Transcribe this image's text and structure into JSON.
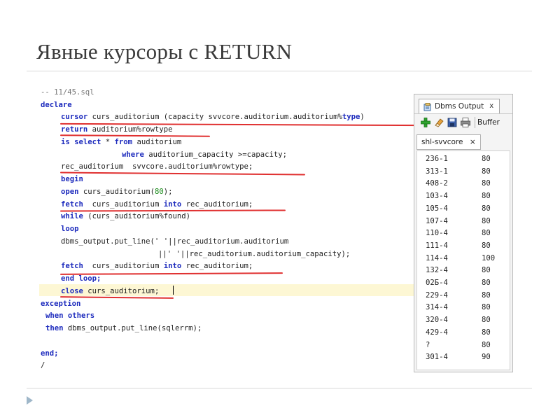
{
  "slide": {
    "title": "Явные курсоры с RETURN"
  },
  "code": {
    "comment": "-- 11/45.sql",
    "l2": "declare",
    "l3a": "cursor",
    "l3b": " curs_auditorium (capacity svvcore.auditorium.auditorium%",
    "l3c": "type",
    "l3d": ")",
    "l4a": "return",
    "l4b": " auditorium%rowtype",
    "l5a": "is select",
    "l5b": " * ",
    "l5c": "from",
    "l5d": " auditorium",
    "l6a": "where",
    "l6b": " auditorium_capacity >=capacity;",
    "l7": "rec_auditorium  svvcore.auditorium%rowtype;",
    "l8": "begin",
    "l9a": "open",
    "l9b": " curs_auditorium(",
    "l9c": "80",
    "l9d": ");",
    "l10a": "fetch",
    "l10b": "  curs_auditorium ",
    "l10c": "into",
    "l10d": " rec_auditorium;",
    "l11a": "while",
    "l11b": " (curs_auditorium%found)",
    "l12": "loop",
    "l13": "dbms_output.put_line(' '||rec_auditorium.auditorium",
    "l14": "||' '||rec_auditorium.auditorium_capacity);",
    "l15a": "fetch",
    "l15b": "  curs_auditorium ",
    "l15c": "into",
    "l15d": " rec_auditorium;",
    "l16": "end loop;",
    "l17a": "close",
    "l17b": " curs_auditorium;",
    "l18": "exception",
    "l19": "when others",
    "l20a": "then",
    "l20b": " dbms_output.put_line(sqlerrm);",
    "l21": "end;",
    "l22": "/"
  },
  "dbms_panel": {
    "tab_label": "Dbms Output",
    "close_glyph": "x",
    "toolbar": {
      "buffer_label": "Buffer"
    },
    "subtab_label": "shl-svvcore",
    "subtab_close": "×",
    "rows": [
      [
        "236-1",
        "80"
      ],
      [
        "313-1",
        "80"
      ],
      [
        "408-2",
        "80"
      ],
      [
        "103-4",
        "80"
      ],
      [
        "105-4",
        "80"
      ],
      [
        "107-4",
        "80"
      ],
      [
        "110-4",
        "80"
      ],
      [
        "111-4",
        "80"
      ],
      [
        "114-4",
        "100"
      ],
      [
        "132-4",
        "80"
      ],
      [
        "02Б-4",
        "80"
      ],
      [
        "229-4",
        "80"
      ],
      [
        "314-4",
        "80"
      ],
      [
        "320-4",
        "80"
      ],
      [
        "429-4",
        "80"
      ],
      [
        "?",
        "80"
      ],
      [
        "301-4",
        "90"
      ]
    ]
  },
  "colors": {
    "keyword": "#1d2bbd",
    "underline": "#e03030",
    "number": "#1a8a1a"
  },
  "icons": [
    "add-icon",
    "eraser-icon",
    "save-icon",
    "print-icon",
    "dbms-output-icon",
    "close-icon",
    "bullet-arrow-icon"
  ]
}
